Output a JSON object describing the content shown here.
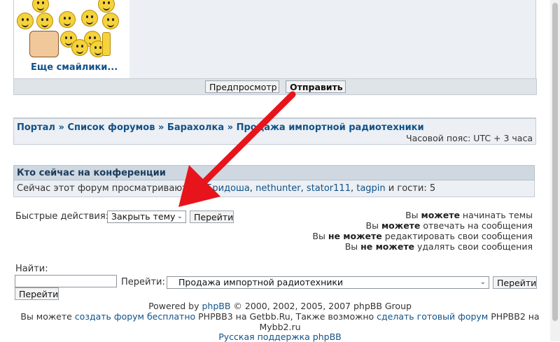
{
  "smilies": {
    "more_label": "Еще смайлики..."
  },
  "postbar": {
    "preview_label": "Предпросмотр",
    "submit_label": "Отправить"
  },
  "breadcrumbs": {
    "items": [
      "Портал",
      "Список форумов",
      "Барахолка",
      "Продажа импортной радиотехники"
    ],
    "separator": "»"
  },
  "timezone": "Часовой пояс: UTC + 3 часа",
  "whois": {
    "heading": "Кто сейчас на конференции",
    "prefix": "Сейчас этот форум просматривают: ",
    "users": [
      "Ж.Бридоша",
      "nethunter",
      "stator111",
      "tagpin"
    ],
    "suffix": " и гости: 5"
  },
  "quick_actions": {
    "label": "Быстрые действия:",
    "selected": "Закрыть тему",
    "go_label": "Перейти"
  },
  "permissions": [
    {
      "pre": "Вы ",
      "strong": "можете",
      "post": " начинать темы"
    },
    {
      "pre": "Вы ",
      "strong": "можете",
      "post": " отвечать на сообщения"
    },
    {
      "pre": "Вы ",
      "strong": "не можете",
      "post": " редактировать свои сообщения"
    },
    {
      "pre": "Вы ",
      "strong": "не можете",
      "post": " удалять свои сообщения"
    }
  ],
  "search": {
    "label": "Найти:",
    "value": "",
    "go_label": "Перейти"
  },
  "jump": {
    "label": "Перейти:",
    "selected": "Продажа импортной радиотехники",
    "go_label": "Перейти"
  },
  "footer": {
    "powered_prefix": "Powered by ",
    "powered_link": "phpBB",
    "powered_suffix": " © 2000, 2002, 2005, 2007 phpBB Group",
    "line2_pre": "Вы можете ",
    "line2_link1": "создать форум бесплатно",
    "line2_mid": " PHPBB3 на Getbb.Ru, Также возможно ",
    "line2_link2": "сделать готовый форум",
    "line2_post": " PHPBB2 на",
    "line3": "Mybb2.ru",
    "line4_link": "Русская поддержка phpBB"
  },
  "colors": {
    "link": "#105289",
    "arrow": "#e8141b",
    "header_bg": "#cfd7e0",
    "panel_bg": "#eceff3"
  }
}
